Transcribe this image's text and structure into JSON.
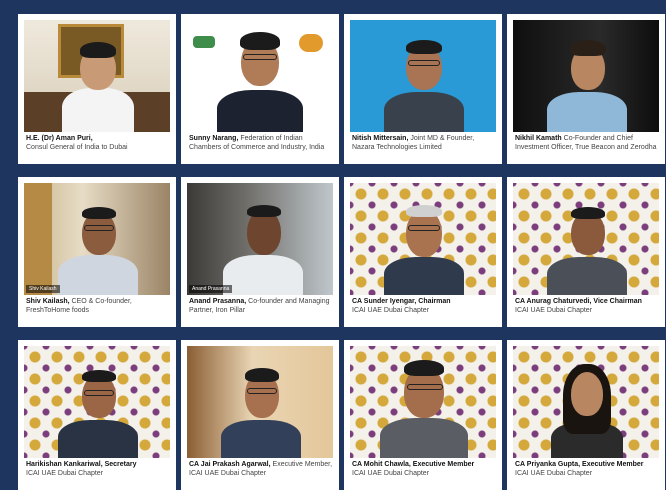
{
  "tiles": [
    {
      "name": "H.E. (Dr) Aman Puri,",
      "role": "Consul General of India to Dubai",
      "tag": ""
    },
    {
      "name": "Sunny Narang,",
      "role": "Federation of Indian Chambers of Commerce and Industry, India",
      "tag": ""
    },
    {
      "name": "Nitish Mittersain,",
      "role": "Joint MD & Founder, Nazara Technologies Limited",
      "tag": ""
    },
    {
      "name": "Nikhil Kamath",
      "role": "Co-Founder and Chief Investment Officer, True Beacon and Zerodha",
      "tag": ""
    },
    {
      "name": "Shiv Kailash,",
      "role": "CEO & Co-founder, FreshToHome foods",
      "tag": "Shiv Kailash"
    },
    {
      "name": "Anand Prasanna,",
      "role": "Co-founder and Managing Partner, Iron Pillar",
      "tag": "Anand Prasanna"
    },
    {
      "name": "CA Sunder Iyengar, Chairman",
      "role": "ICAI UAE Dubai Chapter",
      "tag": ""
    },
    {
      "name": "CA Anurag Chaturvedi, Vice Chairman",
      "role": "ICAI UAE Dubai Chapter",
      "tag": ""
    },
    {
      "name": "Harikishan Kankariwal, Secretary",
      "role": "ICAI UAE Dubai Chapter",
      "tag": ""
    },
    {
      "name": "CA Jai Prakash Agarwal,",
      "role": "Executive Member, ICAI UAE Dubai Chapter",
      "tag": ""
    },
    {
      "name": "CA Mohit Chawla, Executive Member",
      "role": "ICAI UAE Dubai Chapter",
      "tag": ""
    },
    {
      "name": "CA Priyanka Gupta, Executive Member",
      "role": "ICAI UAE Dubai Chapter",
      "tag": ""
    }
  ]
}
